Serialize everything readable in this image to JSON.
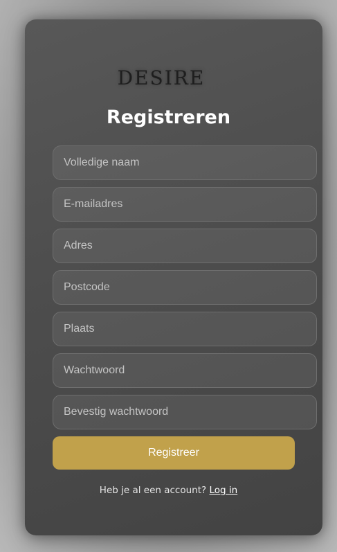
{
  "brand": {
    "logo_text": "DESIRE"
  },
  "form": {
    "title": "Registreren",
    "fields": {
      "full_name": {
        "placeholder": "Volledige naam",
        "value": ""
      },
      "email": {
        "placeholder": "E-mailadres",
        "value": ""
      },
      "address": {
        "placeholder": "Adres",
        "value": ""
      },
      "postcode": {
        "placeholder": "Postcode",
        "value": ""
      },
      "city": {
        "placeholder": "Plaats",
        "value": ""
      },
      "password": {
        "placeholder": "Wachtwoord",
        "value": ""
      },
      "confirm_password": {
        "placeholder": "Bevestig wachtwoord",
        "value": ""
      }
    },
    "submit_label": "Registreer"
  },
  "footer": {
    "prompt": "Heb je al een account?",
    "login_link": "Log in"
  },
  "colors": {
    "accent": "#c1a14b",
    "card": "#4d4d4d"
  }
}
